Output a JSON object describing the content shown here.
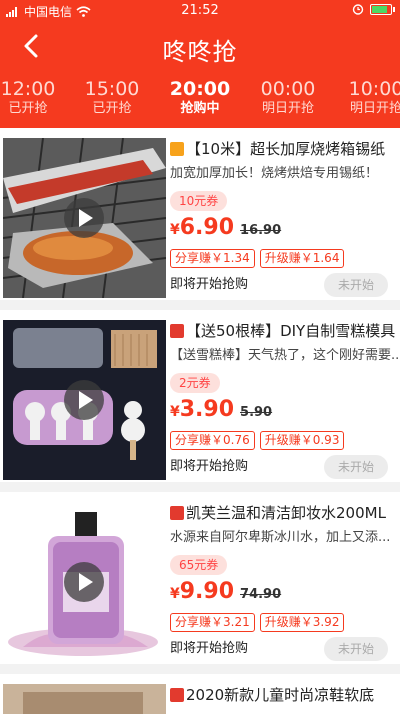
{
  "status_bar": {
    "carrier": "中国电信",
    "time": "21:52"
  },
  "header": {
    "title": "咚咚抢"
  },
  "tabs": [
    {
      "time": "12:00",
      "state": "已开抢",
      "active": false
    },
    {
      "time": "15:00",
      "state": "已开抢",
      "active": false
    },
    {
      "time": "20:00",
      "state": "抢购中",
      "active": true
    },
    {
      "time": "00:00",
      "state": "明日开抢",
      "active": false
    },
    {
      "time": "10:00",
      "state": "明日开抢",
      "active": false
    }
  ],
  "products": [
    {
      "source_icon": "pinduoduo-icon",
      "title": "【10米】超长加厚烧烤箱锡纸",
      "desc": "加宽加厚加长！烧烤烘焙专用锡纸！",
      "coupon": "10元券",
      "currency": "¥",
      "price": "6.90",
      "orig": "16.90",
      "share": "分享赚￥1.34",
      "upgrade": "升级赚￥1.64",
      "soon": "即将开始抢购",
      "button": "未开始"
    },
    {
      "source_icon": "tmall-icon",
      "title": "【送50根棒】DIY自制雪糕模具",
      "desc": "【送雪糕棒】天气热了，这个刚好需要...",
      "coupon": "2元券",
      "currency": "¥",
      "price": "3.90",
      "orig": "5.90",
      "share": "分享赚￥0.76",
      "upgrade": "升级赚￥0.93",
      "soon": "即将开始抢购",
      "button": "未开始"
    },
    {
      "source_icon": "tmall-icon",
      "title": "凯芙兰温和清洁卸妆水200ML",
      "desc": "水源来自阿尔卑斯冰川水，加上又添...",
      "coupon": "65元券",
      "currency": "¥",
      "price": "9.90",
      "orig": "74.90",
      "share": "分享赚￥3.21",
      "upgrade": "升级赚￥3.92",
      "soon": "即将开始抢购",
      "button": "未开始"
    },
    {
      "source_icon": "tmall-icon",
      "title": "2020新款儿童时尚凉鞋软底"
    }
  ],
  "colors": {
    "brand": "#f53a1f",
    "coupon_bg": "#fde0dc"
  }
}
